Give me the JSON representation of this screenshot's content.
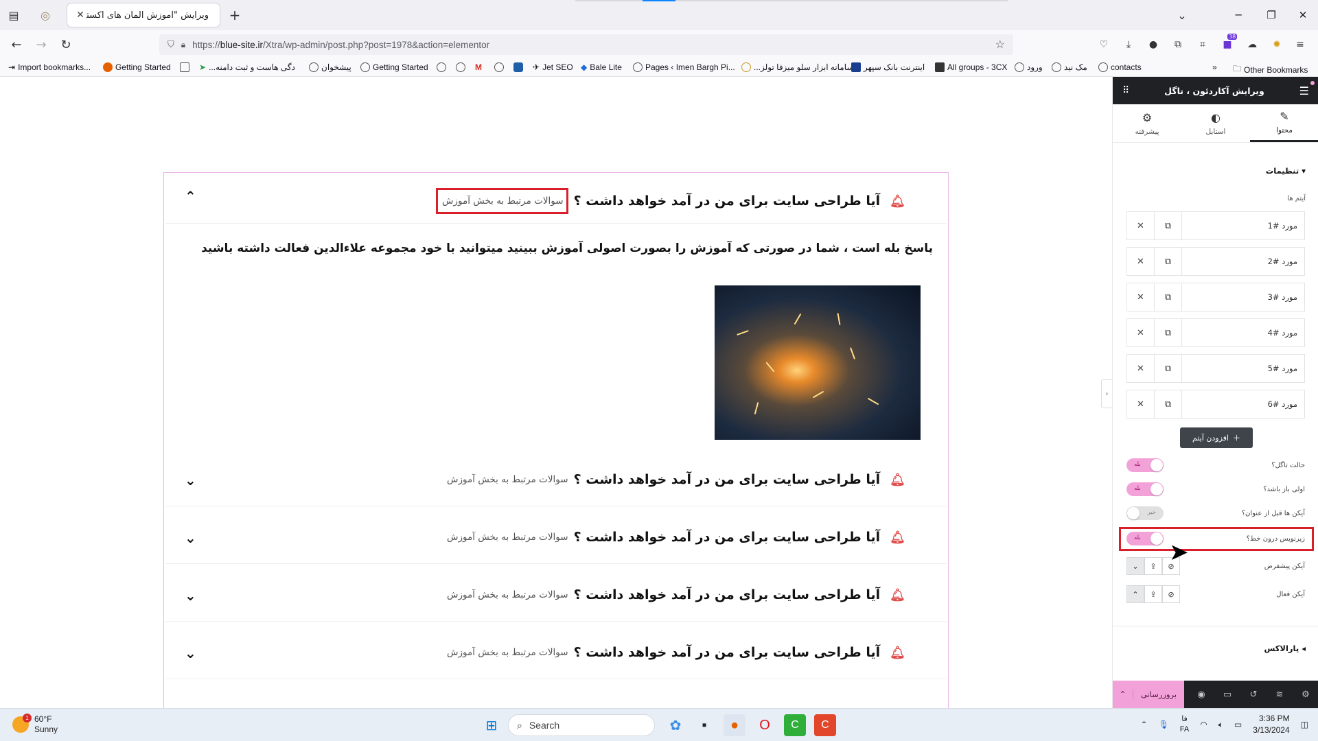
{
  "browser": {
    "tab_title": "ویرایش \"آموزش المان های اکسترا – ع",
    "url_prefix": "https://",
    "url_domain": "blue-site.ir",
    "url_path": "/Xtra/wp-admin/post.php?post=1978&action=elementor",
    "extension_badge": "38",
    "bookmarks": [
      "Import bookmarks...",
      "Getting Started",
      "...دگی هاست و ثبت دامنه",
      "پیشخوان",
      "Getting Started",
      "Jet SEO",
      "Bale Lite",
      "Pages ‹ Imen Bargh Pi...",
      "...سامانه ابزار سلو میزفا تولز",
      "اینترنت بانک سپهر",
      "All groups - 3CX",
      "ورود",
      "مک نید",
      "contacts"
    ],
    "other_bookmarks": "Other Bookmarks"
  },
  "accordion": {
    "question": "آیا طراحی سایت برای من در آمد خواهد داشت ؟",
    "subtitle": "سوالات مرتبط به بخش آموزش",
    "answer": "پاسخ بله است ، شما در صورتی که آموزش را بصورت اصولی آموزش ببینید میتوانید با خود مجموعه علاءالدین فعالت داشته باشید",
    "rows": 5
  },
  "panel": {
    "header_title": "ویرایش آکاردئون ، تاگل",
    "tabs": {
      "content": "محتوا",
      "style": "استایل",
      "advanced": "پیشرفته"
    },
    "section_settings": "تنظیمات",
    "items_label": "آیتم ها",
    "items": [
      "مورد #1",
      "مورد #2",
      "مورد #3",
      "مورد #4",
      "مورد #5",
      "مورد #6"
    ],
    "add_item": "افزودن آیتم",
    "controls": {
      "toggle_mode": "حالت تاگل؟",
      "first_open": "اولی باز باشد؟",
      "icons_before_title": "آیکن ها قبل از عنوان؟",
      "inline_subtitle": "زیرنویس درون خط؟",
      "default_icon": "آیکن پیشفرض",
      "active_icon": "آیکن فعال",
      "yes": "بله",
      "no": "خیر"
    },
    "section_parallax": "پارالاکس",
    "update_button": "بروزرسانی"
  },
  "taskbar": {
    "weather_temp": "60°F",
    "weather_desc": "Sunny",
    "weather_badge": "1",
    "search_placeholder": "Search",
    "lang_top": "فا",
    "lang_bottom": "FA",
    "time": "3:36 PM",
    "date": "3/13/2024"
  },
  "colors": {
    "highlight_red": "#d9202a",
    "toggle_pink": "#f3a2d9",
    "accordion_border": "#e6b5e8",
    "panel_dark": "#1f2124"
  }
}
